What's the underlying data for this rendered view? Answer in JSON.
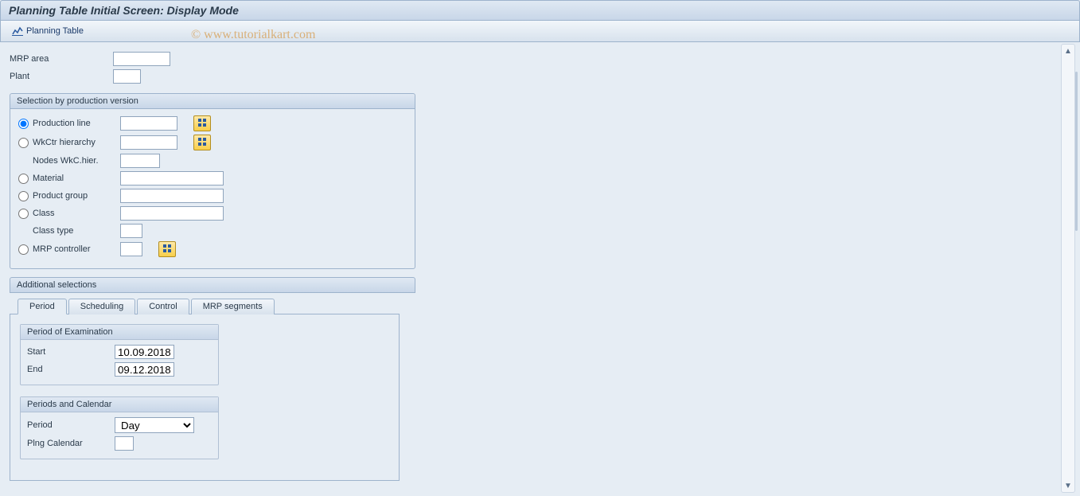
{
  "title": "Planning Table Initial Screen: Display Mode",
  "toolbar": {
    "planning_table": "Planning Table"
  },
  "watermark": "© www.tutorialkart.com",
  "top_fields": {
    "mrp_area_label": "MRP area",
    "mrp_area_value": "",
    "plant_label": "Plant",
    "plant_value": ""
  },
  "selection_group": {
    "title": "Selection by production version",
    "production_line_label": "Production line",
    "production_line_value": "",
    "wkctr_hierarchy_label": "WkCtr hierarchy",
    "wkctr_hierarchy_value": "",
    "nodes_wkc_hier_label": "Nodes WkC.hier.",
    "nodes_wkc_hier_value": "",
    "material_label": "Material",
    "material_value": "",
    "product_group_label": "Product group",
    "product_group_value": "",
    "class_label": "Class",
    "class_value": "",
    "class_type_label": "Class type",
    "class_type_value": "",
    "mrp_controller_label": "MRP controller",
    "mrp_controller_value": ""
  },
  "additional_selections": {
    "title": "Additional selections",
    "tabs": {
      "period": "Period",
      "scheduling": "Scheduling",
      "control": "Control",
      "mrp_segments": "MRP segments"
    },
    "period_tab": {
      "period_examination_title": "Period of Examination",
      "start_label": "Start",
      "start_value": "10.09.2018",
      "end_label": "End",
      "end_value": "09.12.2018",
      "periods_calendar_title": "Periods and Calendar",
      "period_label": "Period",
      "period_value": "Day",
      "period_options": [
        "Day"
      ],
      "plng_calendar_label": "Plng Calendar",
      "plng_calendar_value": ""
    }
  }
}
